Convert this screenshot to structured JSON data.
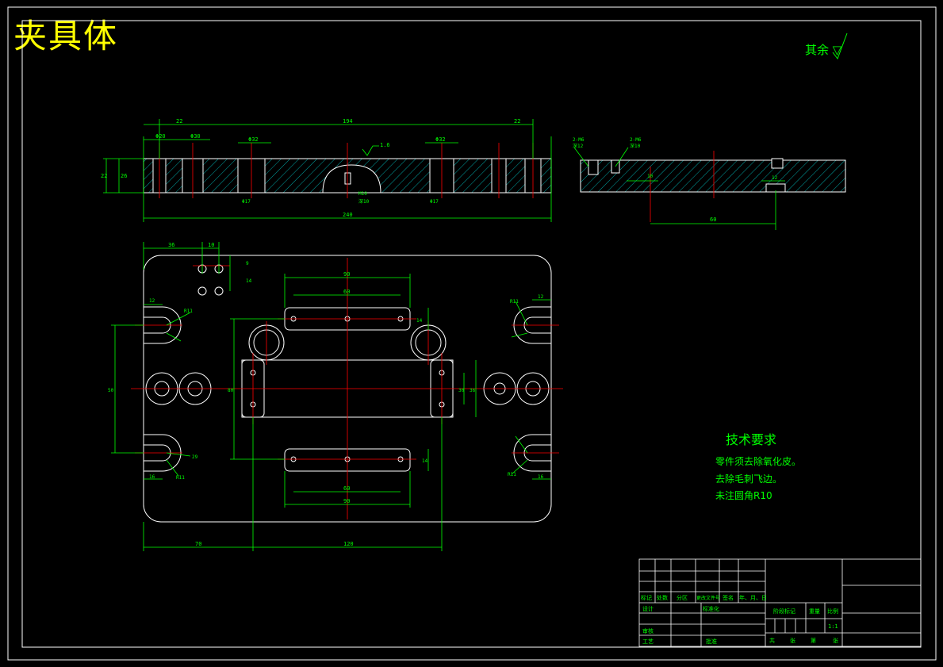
{
  "title": "夹具体",
  "roughness_note": "其余",
  "technical_requirements": {
    "heading": "技术要求",
    "items": [
      "零件须去除氧化皮。",
      "去除毛刺飞边。",
      "未注圆角R10"
    ]
  },
  "section_dims": {
    "d22a": "22",
    "d194": "194",
    "d22b": "22",
    "phi20": "Φ20",
    "phi30": "Φ30",
    "phi32a": "Φ32",
    "phi32b": "Φ32",
    "ra16": "1.6",
    "d22v": "22",
    "d26v": "26",
    "d240": "240",
    "m10a": "M10",
    "m10b": "M10",
    "m10c": "M10",
    "phi17a": "Φ17",
    "phi17b": "Φ17",
    "dp": "深10"
  },
  "side_dims": {
    "m6a": "2-M6",
    "dp12": "深12",
    "m6b": "2-M6",
    "dp10": "深10",
    "d10": "10",
    "d60": "60",
    "d12": "12",
    "ra16": "1.6"
  },
  "plan_dims": {
    "d36": "36",
    "d10": "10",
    "d9": "9",
    "d14": "14",
    "d90a": "90",
    "d60a": "60",
    "d14b": "14",
    "d14c": "14",
    "d60b": "60",
    "d90b": "90",
    "r11a": "R11",
    "r11b": "R11",
    "r11c": "R11",
    "r11d": "R11",
    "d12a": "12",
    "d12b": "12",
    "d16a": "16",
    "d16b": "16",
    "d30": "30",
    "d36b": "36",
    "d80": "80",
    "d50": "50",
    "d70": "70",
    "d120": "120",
    "d29": "29"
  },
  "title_block": {
    "headers": [
      "标记",
      "处数",
      "分区",
      "更改文件号",
      "签名",
      "年、月、日"
    ],
    "design": "设计",
    "standard": "标准化",
    "review": "审核",
    "process": "工艺",
    "approve": "批准",
    "stage_mark": "阶段标记",
    "weight": "重量",
    "scale": "比例",
    "scale_value": "1:1",
    "sheets": [
      "共",
      "张",
      "第",
      "张"
    ]
  }
}
